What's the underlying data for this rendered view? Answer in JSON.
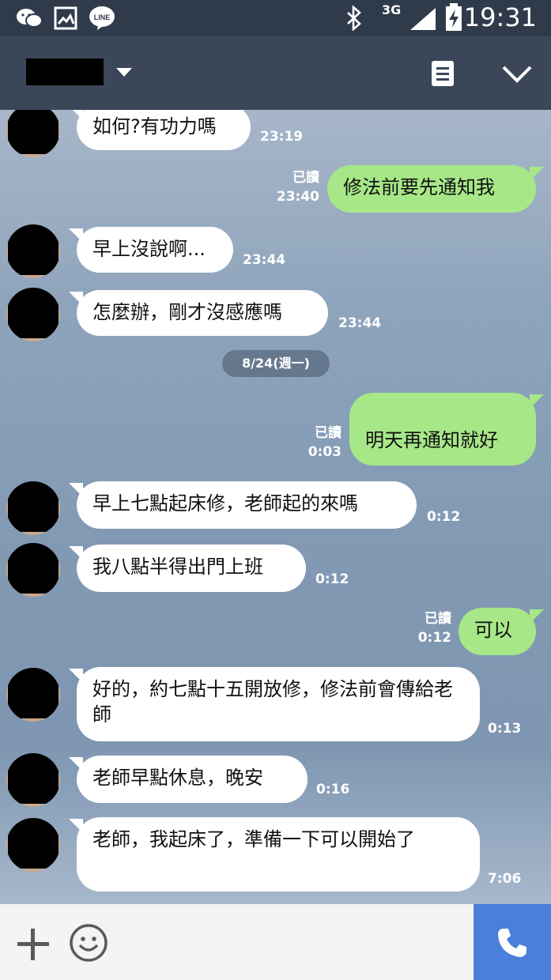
{
  "status_bar": {
    "time": "19:31",
    "network": "3G",
    "icons": [
      "wechat-icon",
      "gallery-icon",
      "line-icon",
      "bluetooth-icon",
      "signal-icon",
      "battery-charging-icon"
    ]
  },
  "header": {
    "name_hidden": true,
    "icons": [
      "dropdown-arrow-icon",
      "notes-icon",
      "chevron-down-icon"
    ]
  },
  "messages": [
    {
      "side": "in",
      "text": "如何?有功力嗎",
      "time": "23:19"
    },
    {
      "side": "out",
      "text": "修法前要先通知我",
      "read": "已讀",
      "time": "23:40"
    },
    {
      "side": "in",
      "text": "早上沒說啊...",
      "time": "23:44"
    },
    {
      "side": "in",
      "text": "怎麼辦，剛才沒感應嗎",
      "time": "23:44"
    },
    {
      "side": "out",
      "text": "明天再通知就好",
      "read": "已讀",
      "time": "0:03"
    },
    {
      "side": "in",
      "text": "早上七點起床修，老師起的來嗎",
      "time": "0:12"
    },
    {
      "side": "in",
      "text": "我八點半得出門上班",
      "time": "0:12"
    },
    {
      "side": "out",
      "text": "可以",
      "read": "已讀",
      "time": "0:12"
    },
    {
      "side": "in",
      "text": "好的，約七點十五開放修，修法前會傳給老師",
      "time": "0:13"
    },
    {
      "side": "in",
      "text": "老師早點休息，晚安",
      "time": "0:16"
    },
    {
      "side": "in",
      "text": "老師，我起床了，準備一下可以開始了",
      "time": "7:06"
    }
  ],
  "date_divider": "8/24(週一)",
  "input_bar": {
    "icons": [
      "plus-icon",
      "emoji-icon",
      "phone-call-icon"
    ]
  },
  "colors": {
    "out_bubble": "#a7e788",
    "in_bubble": "#ffffff",
    "header": "#3b4658",
    "call_button": "#4a7fdb"
  }
}
